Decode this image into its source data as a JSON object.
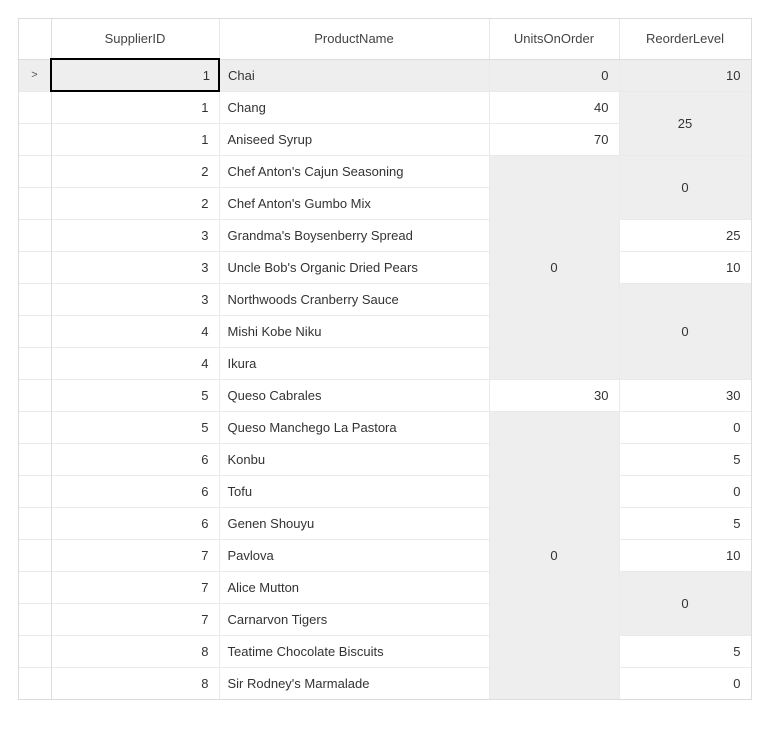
{
  "columns": {
    "supplier": "SupplierID",
    "product": "ProductName",
    "units": "UnitsOnOrder",
    "reorder": "ReorderLevel"
  },
  "indicator_glyph": ">",
  "rows": [
    {
      "supplier": "1",
      "product": "Chai",
      "units": "0",
      "reorder": "10"
    },
    {
      "supplier": "1",
      "product": "Chang",
      "units": "40"
    },
    {
      "supplier": "1",
      "product": "Aniseed Syrup",
      "units": "70"
    },
    {
      "supplier": "2",
      "product": "Chef Anton's Cajun Seasoning"
    },
    {
      "supplier": "2",
      "product": "Chef Anton's Gumbo Mix"
    },
    {
      "supplier": "3",
      "product": "Grandma's Boysenberry Spread",
      "reorder": "25"
    },
    {
      "supplier": "3",
      "product": "Uncle Bob's Organic Dried Pears",
      "reorder": "10"
    },
    {
      "supplier": "3",
      "product": "Northwoods Cranberry Sauce"
    },
    {
      "supplier": "4",
      "product": "Mishi Kobe Niku"
    },
    {
      "supplier": "4",
      "product": "Ikura"
    },
    {
      "supplier": "5",
      "product": "Queso Cabrales",
      "units": "30",
      "reorder": "30"
    },
    {
      "supplier": "5",
      "product": "Queso Manchego La Pastora",
      "reorder": "0"
    },
    {
      "supplier": "6",
      "product": "Konbu",
      "reorder": "5"
    },
    {
      "supplier": "6",
      "product": "Tofu",
      "reorder": "0"
    },
    {
      "supplier": "6",
      "product": "Genen Shouyu",
      "reorder": "5"
    },
    {
      "supplier": "7",
      "product": "Pavlova",
      "reorder": "10"
    },
    {
      "supplier": "7",
      "product": "Alice Mutton"
    },
    {
      "supplier": "7",
      "product": "Carnarvon Tigers"
    },
    {
      "supplier": "8",
      "product": "Teatime Chocolate Biscuits",
      "reorder": "5"
    },
    {
      "supplier": "8",
      "product": "Sir Rodney's Marmalade",
      "reorder": "0"
    }
  ],
  "merged": {
    "units_a": "0",
    "units_b": "0",
    "reorder_25": "25",
    "reorder_0a": "0",
    "reorder_0b": "0",
    "reorder_0c": "0"
  }
}
